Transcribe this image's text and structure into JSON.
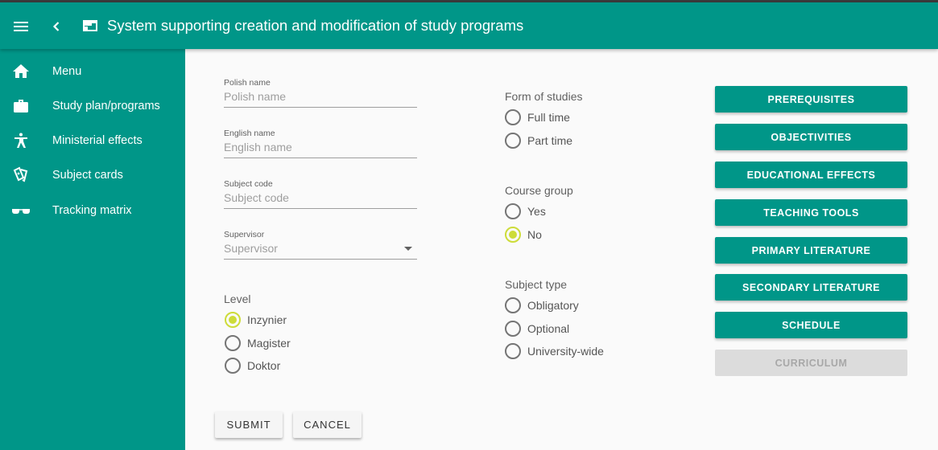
{
  "app": {
    "title": "System supporting creation and modification of study programs"
  },
  "header_icons": {
    "menu": "menu-icon",
    "back": "chevron-left-icon",
    "title": "web-window-icon"
  },
  "sidebar": {
    "items": [
      {
        "label": "Menu",
        "icon": "home-icon"
      },
      {
        "label": "Study plan/programs",
        "icon": "briefcase-icon"
      },
      {
        "label": "Ministerial effects",
        "icon": "accessibility-icon"
      },
      {
        "label": "Subject cards",
        "icon": "cards-icon"
      },
      {
        "label": "Tracking matrix",
        "icon": "glasses-icon"
      }
    ]
  },
  "form": {
    "polish_name": {
      "label": "Polish name",
      "placeholder": "Polish name",
      "value": ""
    },
    "english_name": {
      "label": "English name",
      "placeholder": "English name",
      "value": ""
    },
    "subject_code": {
      "label": "Subject code",
      "placeholder": "Subject code",
      "value": ""
    },
    "supervisor": {
      "label": "Supervisor",
      "placeholder": "Supervisor"
    },
    "level": {
      "title": "Level",
      "options": [
        "Inzynier",
        "Magister",
        "Doktor"
      ],
      "selected": "Inzynier"
    },
    "form_of_studies": {
      "title": "Form of studies",
      "options": [
        "Full time",
        "Part time"
      ],
      "selected": null
    },
    "course_group": {
      "title": "Course group",
      "options": [
        "Yes",
        "No"
      ],
      "selected": "No"
    },
    "subject_type": {
      "title": "Subject type",
      "options": [
        "Obligatory",
        "Optional",
        "University-wide"
      ],
      "selected": null
    }
  },
  "actions": {
    "buttons": [
      "PREREQUISITES",
      "OBJECTIVITIES",
      "EDUCATIONAL EFFECTS",
      "TEACHING TOOLS",
      "PRIMARY LITERATURE",
      "SECONDARY LITERATURE",
      "SCHEDULE",
      "CURRICULUM"
    ],
    "disabled": [
      "CURRICULUM"
    ],
    "submit": "SUBMIT",
    "cancel": "CANCEL"
  },
  "colors": {
    "primary": "#009688",
    "accent": "#cddc39",
    "disabled_bg": "#dcdcdc",
    "background": "#fafafa"
  }
}
